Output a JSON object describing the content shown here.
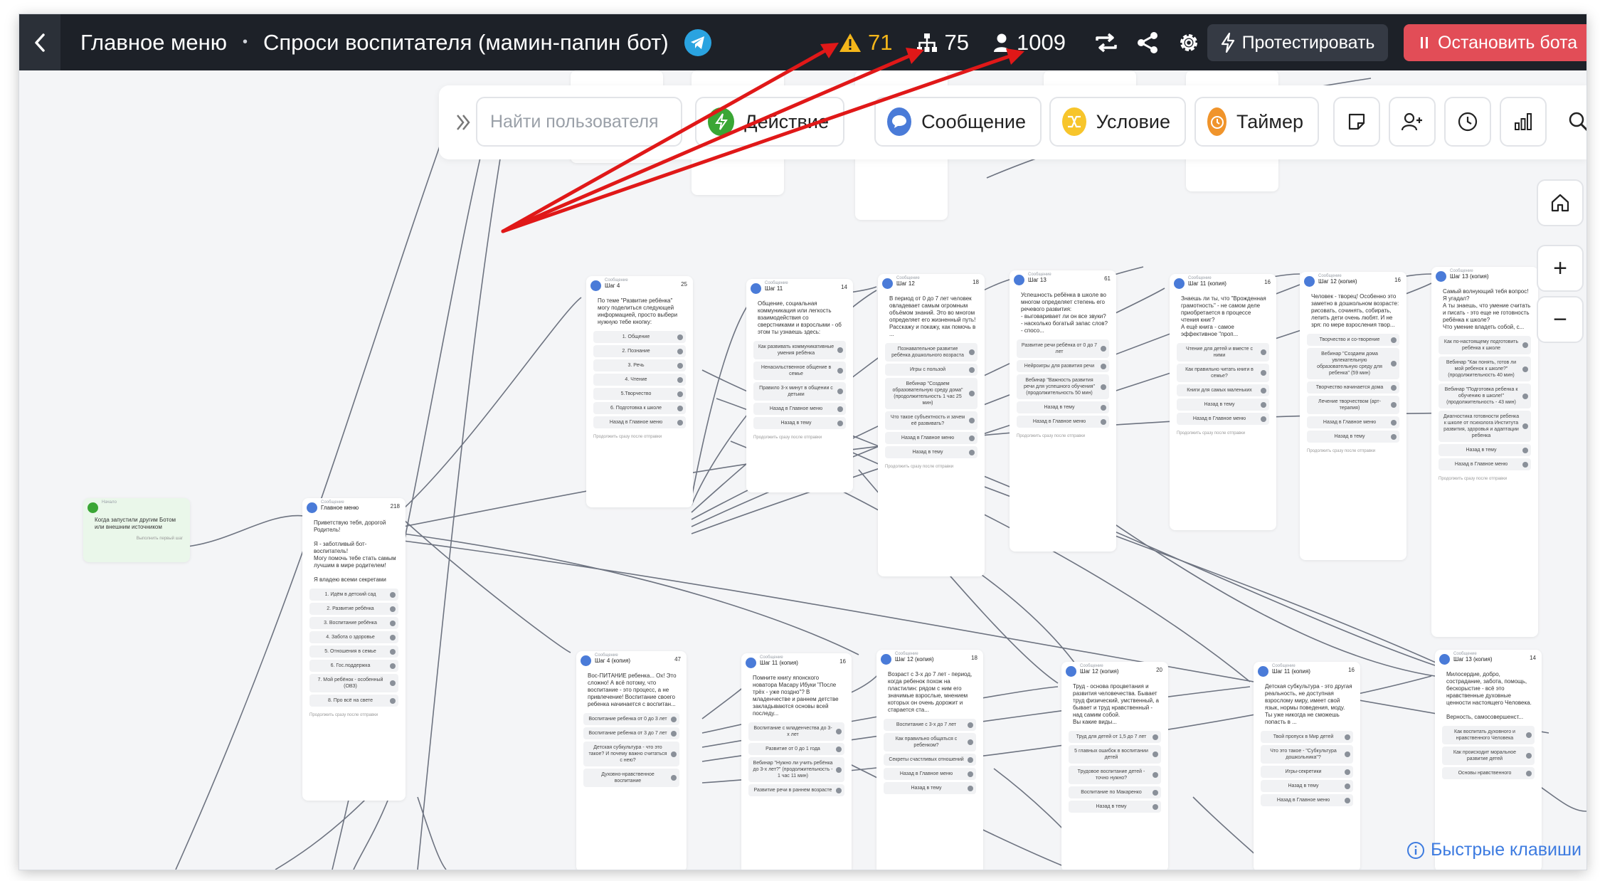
{
  "topbar": {
    "crumb_main": "Главное меню",
    "crumb_sep": "•",
    "crumb_bot": "Спроси воспитателя (мамин-папин бот)",
    "stats": {
      "warnings": "71",
      "structure": "75",
      "users": "1009"
    },
    "test_label": "Протестировать",
    "stop_label": "Остановить бота"
  },
  "toolbar": {
    "search_placeholder": "Найти пользователя",
    "action_label": "Действие",
    "message_label": "Сообщение",
    "condition_label": "Условие",
    "timer_label": "Таймер"
  },
  "zoom": {
    "plus": "+",
    "minus": "−"
  },
  "hotkeys_label": "Быстрые клавиши",
  "colors": {
    "accent_red": "#e24d57",
    "warning": "#f4b61a",
    "action_green": "#3aa635",
    "message_blue": "#4a7bd8",
    "condition_yellow": "#f7c52b",
    "timer_orange": "#f0942b"
  },
  "nodes": {
    "start": {
      "type": "Начало",
      "text": "Когда запустили другим Ботом или внешним источником",
      "foot": "Выполнить первый шаг"
    },
    "main": {
      "type": "Сообщение",
      "title": "Главное меню",
      "count": "218",
      "text": "Приветствую тебя, дорогой Родитель!\n\nЯ - заботливый бот-воспитатель!\nМогу помочь тебе стать самым лучшим в мире родителем!\n\nЯ владею всеми секретами",
      "buttons": [
        "1. Идём в детский сад",
        "2. Развитие ребёнка",
        "3. Воспитание ребёнка",
        "4. Забота о здоровье",
        "5. Отношения в семье",
        "6. Гос.поддержка",
        "7. Мой ребёнок - особенный (ОВЗ)",
        "8. Про всё на свете"
      ],
      "foot": "Продолжить сразу после отправки"
    },
    "step4": {
      "type": "Сообщение",
      "title": "Шаг 4",
      "count": "25",
      "text": "По теме \"Развитие ребёнка\" могу поделиться следующей информацией, просто выбери нужную тебе кнопку:",
      "buttons": [
        "1. Общение",
        "2. Познание",
        "3. Речь",
        "4. Чтение",
        "5.Творчество",
        "6. Подготовка к школе",
        "Назад в Главное меню"
      ],
      "foot": "Продолжить сразу после отправки"
    },
    "step11": {
      "type": "Сообщение",
      "title": "Шаг 11",
      "count": "14",
      "text": "Общение, социальная коммуникация или легкость взаимодействия со сверстниками и взрослыми - об этом ты узнаешь здесь:",
      "buttons": [
        "Как развивать коммуникативные умения ребёнка",
        "Ненасильственное общение в семье",
        "Правило 3-х минут в общении с детьми",
        "Назад в Главное меню",
        "Назад в тему"
      ],
      "foot": "Продолжить сразу после отправки"
    },
    "step12": {
      "type": "Сообщение",
      "title": "Шаг 12",
      "count": "18",
      "text": "В период от 0 до 7 лет человек овладевает самым огромным объёмом знаний. Это во многом определяет его жизненный путь! Расскажу и покажу, как помочь в ...",
      "buttons": [
        "Познавательное развитие ребёнка дошкольного возраста",
        "Игры с пользой",
        "Вебинар \"Создаем образовательную среду дома\" (продолжительность 1 час 25 мин)",
        "Что такое субъектность и зачем её развивать?",
        "Назад в Главное меню",
        "Назад в тему"
      ],
      "foot": "Продолжить сразу после отправки"
    },
    "step13": {
      "type": "Сообщение",
      "title": "Шаг 13",
      "count": "61",
      "text": "Успешность ребёнка в школе во многом определяет степень его речевого развития:\n- выговаривает ли он все звуки?\n- насколько богатый запас слов?\n- спосо...",
      "buttons": [
        "Развитие речи ребёнка от 0 до 7 лет",
        "Нейроигры для развития речи",
        "Вебинар \"Важность развития речи для успешного обучения\" (продолжительность 50 мин)",
        "Назад в тему",
        "Назад в Главное меню"
      ],
      "foot": "Продолжить сразу после отправки"
    },
    "step11c": {
      "type": "Сообщение",
      "title": "Шаг 11 (копия)",
      "count": "16",
      "text": "Знаешь ли ты, что \"Врожденная грамотность\" - не самом деле приобретается в процессе чтения книг?\nА ещё книга - самое эффективное \"проп...",
      "buttons": [
        "Чтение для детей и вместе с ними",
        "Как правильно читать книги в семье?",
        "Книги для самых маленьких",
        "Назад в тему",
        "Назад в Главное меню"
      ],
      "foot": "Продолжить сразу после отправки"
    },
    "step12c": {
      "type": "Сообщение",
      "title": "Шаг 12 (копия)",
      "count": "16",
      "text": "Человек - творец! Особенно это заметно в дошкольном возрасте: рисовать, сочинять, собирать, лепить дети очень любят. И не зря: по мере взросления твор...",
      "buttons": [
        "Творчество и со-творение",
        "Вебинар \"Создаем дома увлекательную образовательную среду для ребенка\" (59 мин)",
        "Творчество начинается дома",
        "Лечение творчеством (арт-терапия)",
        "Назад в Главное меню",
        "Назад в тему"
      ],
      "foot": "Продолжить сразу после отправки"
    },
    "step13c": {
      "type": "Сообщение",
      "title": "Шаг 13 (копия)",
      "count": "",
      "text": "Самый волнующий тебя вопрос! Я угадал?\nА ты знаешь, что умение считать и писать - это еще не готовность ребёнка к школе?\nЧто умение владеть собой, с...",
      "buttons": [
        "Как по-настоящему подготовить ребёнка к школе",
        "Вебинар \"Как понять, готов ли мой ребенок к школе?\" (продолжительность 40 мин)",
        "Вебинар \"Подготовка ребенка к обучению в школе!\" (продолжительность - 43 мин)",
        "Диагностика готовности ребенка к школе от психолога Института развития, здоровья и адаптации ребенка",
        "Назад в тему",
        "Назад в Главное меню"
      ],
      "foot": "Продолжить сразу после отправки"
    },
    "step4c": {
      "type": "Сообщение",
      "title": "Шаг 4 (копия)",
      "count": "47",
      "text": "Вос-ПИТАНИЕ ребенка... Ох! Это сложно! А всё потому, что воспитание - это процесс, а не привлечение! Воспитание своего ребенка начинается с воспитан...",
      "buttons": [
        "Воспитание ребенка от 0 до 3 лет",
        "Воспитание ребенка от 3 до 7 лет",
        "Детская субкультура - что это такое? И почему важно считаться с нею?",
        "Духовно-нравственное воспитание"
      ],
      "foot": ""
    },
    "step11c2": {
      "type": "Сообщение",
      "title": "Шаг 11 (копия)",
      "count": "16",
      "text": "Помните книгу японского новатора Масару Ибуки \"После трёх - уже поздно\"? В младенчестве и раннем детстве закладываются основы всей последу...",
      "buttons": [
        "Воспитание с младенчества до 3-х лет",
        "Развитие от 0 до 1 года",
        "Вебинар \"Нужно ли учить ребёнка до 3-х лет?\" (продолжительность - 1 час 11 мин)",
        "Развитие речи в раннем возрасте"
      ],
      "foot": ""
    },
    "step12c2": {
      "type": "Сообщение",
      "title": "Шаг 12 (копия)",
      "count": "18",
      "text": "Возраст с 3-х до 7 лет - период, когда ребенок похож на пластилин: рядом с ним его значимые взрослые, мнением которых он очень дорожит и старается ста...",
      "buttons": [
        "Воспитание с 3-х до 7 лет",
        "Как правильно общаться с ребенком?",
        "Секреты счастливых отношений",
        "Назад в Главное меню",
        "Назад в тему"
      ],
      "foot": ""
    },
    "step12c3": {
      "type": "Сообщение",
      "title": "Шаг 12 (копия)",
      "count": "20",
      "text": "Труд - основа процветания и развития человечества. Бывает труд физический, умственный, а бывает и труд нравственный - над самим собой.\nВы какие виды...",
      "buttons": [
        "Труд для детей от 1,5 до 7 лет",
        "5 главных ошибок в воспитании детей",
        "Трудовое воспитание детей - точно нужно?",
        "Воспитание по Макаренко",
        "Назад в тему"
      ],
      "foot": ""
    },
    "step11c3": {
      "type": "Сообщение",
      "title": "Шаг 11 (копия)",
      "count": "16",
      "text": "Детская субкультура - это другая реальность, не доступная взрослому миру, имеет свой язык, нормы поведения, моду. Ты уже никогда не сможешь попасть в ...",
      "buttons": [
        "Твой пропуск в Мир детей",
        "Что это такое - \"Субкультура дошкольника\"?",
        "Игры-секретики",
        "Назад в тему",
        "Назад в Главное меню"
      ],
      "foot": ""
    },
    "step13c2": {
      "type": "Сообщение",
      "title": "Шаг 13 (копия)",
      "count": "14",
      "text": "Милосердие, добро, сострадание, забота, помощь, бескорыстие - всё это нравственные духовные ценности настоящего Человека.\n\nВерность, самосовершенст...",
      "buttons": [
        "Как воспитать духовного и нравственного Человека",
        "Как происходит моральное развитие детей",
        "Основы нравственного"
      ],
      "foot": ""
    }
  }
}
